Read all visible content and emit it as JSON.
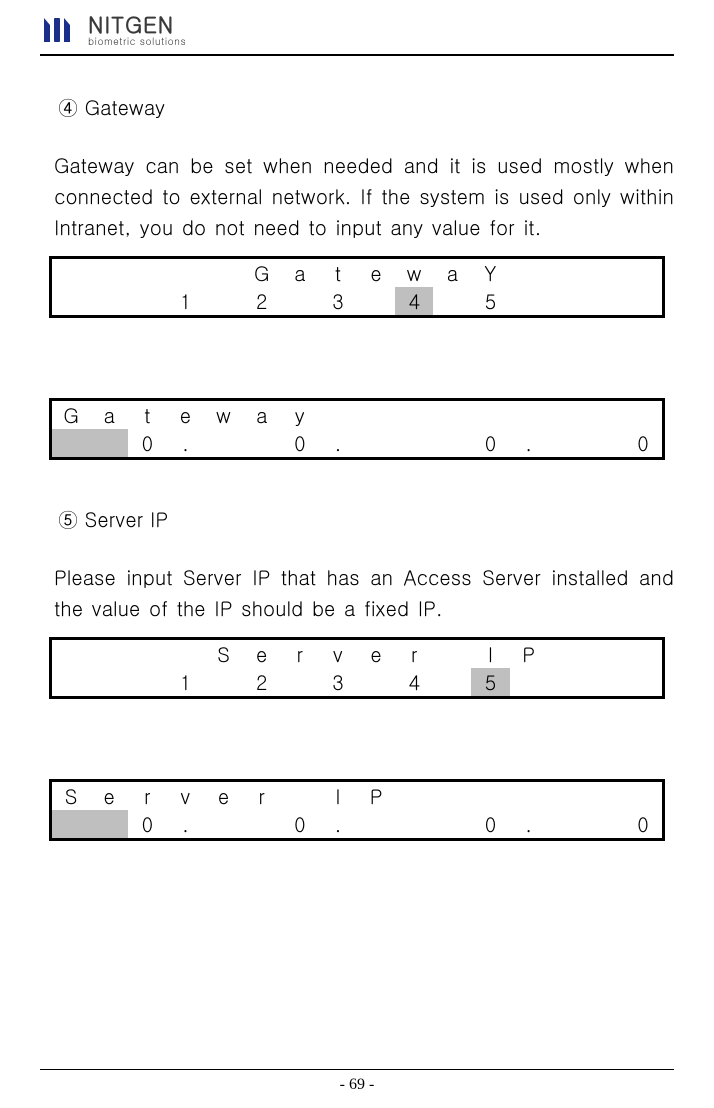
{
  "logo": {
    "brand": "NITGEN",
    "tagline": "biometric solutions"
  },
  "sections": {
    "gateway": {
      "num": "④",
      "title": "Gateway",
      "para": "Gateway can be set when needed and it is used mostly when connected to external network. If the system is used only within Intranet, you do not need to input any value for it.",
      "menu": {
        "titleChars": [
          "G",
          "a",
          "t",
          "e",
          "w",
          "a",
          "Y"
        ],
        "options": [
          "1",
          "2",
          "3",
          "4",
          "5"
        ],
        "selected": "4"
      },
      "value": {
        "labelChars": [
          "G",
          "a",
          "t",
          "e",
          "w",
          "a",
          "y"
        ],
        "cells": [
          {
            "t": " ",
            "hl": true
          },
          {
            "t": " ",
            "hl": true
          },
          {
            "t": "0",
            "hl": false
          },
          {
            "t": ".",
            "hl": false
          },
          {
            "t": " ",
            "hl": false
          },
          {
            "t": " ",
            "hl": false
          },
          {
            "t": "0",
            "hl": false
          },
          {
            "t": ".",
            "hl": false
          },
          {
            "t": " ",
            "hl": false
          },
          {
            "t": " ",
            "hl": false
          },
          {
            "t": " ",
            "hl": false
          },
          {
            "t": "0",
            "hl": false
          },
          {
            "t": ".",
            "hl": false
          },
          {
            "t": " ",
            "hl": false
          },
          {
            "t": " ",
            "hl": false
          },
          {
            "t": "0",
            "hl": false
          }
        ]
      }
    },
    "serverip": {
      "num": "⑤",
      "title": "Server IP",
      "para": "Please input Server IP that has an Access Server installed and the value of the IP should be a fixed IP.",
      "menu": {
        "titleChars": [
          "S",
          "e",
          "r",
          "v",
          "e",
          "r",
          "",
          "I",
          "P"
        ],
        "options": [
          "1",
          "2",
          "3",
          "4",
          "5"
        ],
        "selected": "5"
      },
      "value": {
        "labelChars": [
          "S",
          "e",
          "r",
          "v",
          "e",
          "r",
          "",
          "I",
          "P"
        ],
        "cells": [
          {
            "t": " ",
            "hl": true
          },
          {
            "t": " ",
            "hl": true
          },
          {
            "t": "0",
            "hl": false
          },
          {
            "t": ".",
            "hl": false
          },
          {
            "t": " ",
            "hl": false
          },
          {
            "t": " ",
            "hl": false
          },
          {
            "t": "0",
            "hl": false
          },
          {
            "t": ".",
            "hl": false
          },
          {
            "t": " ",
            "hl": false
          },
          {
            "t": " ",
            "hl": false
          },
          {
            "t": " ",
            "hl": false
          },
          {
            "t": "0",
            "hl": false
          },
          {
            "t": ".",
            "hl": false
          },
          {
            "t": " ",
            "hl": false
          },
          {
            "t": " ",
            "hl": false
          },
          {
            "t": "0",
            "hl": false
          }
        ]
      }
    }
  },
  "page_number": "- 69 -"
}
